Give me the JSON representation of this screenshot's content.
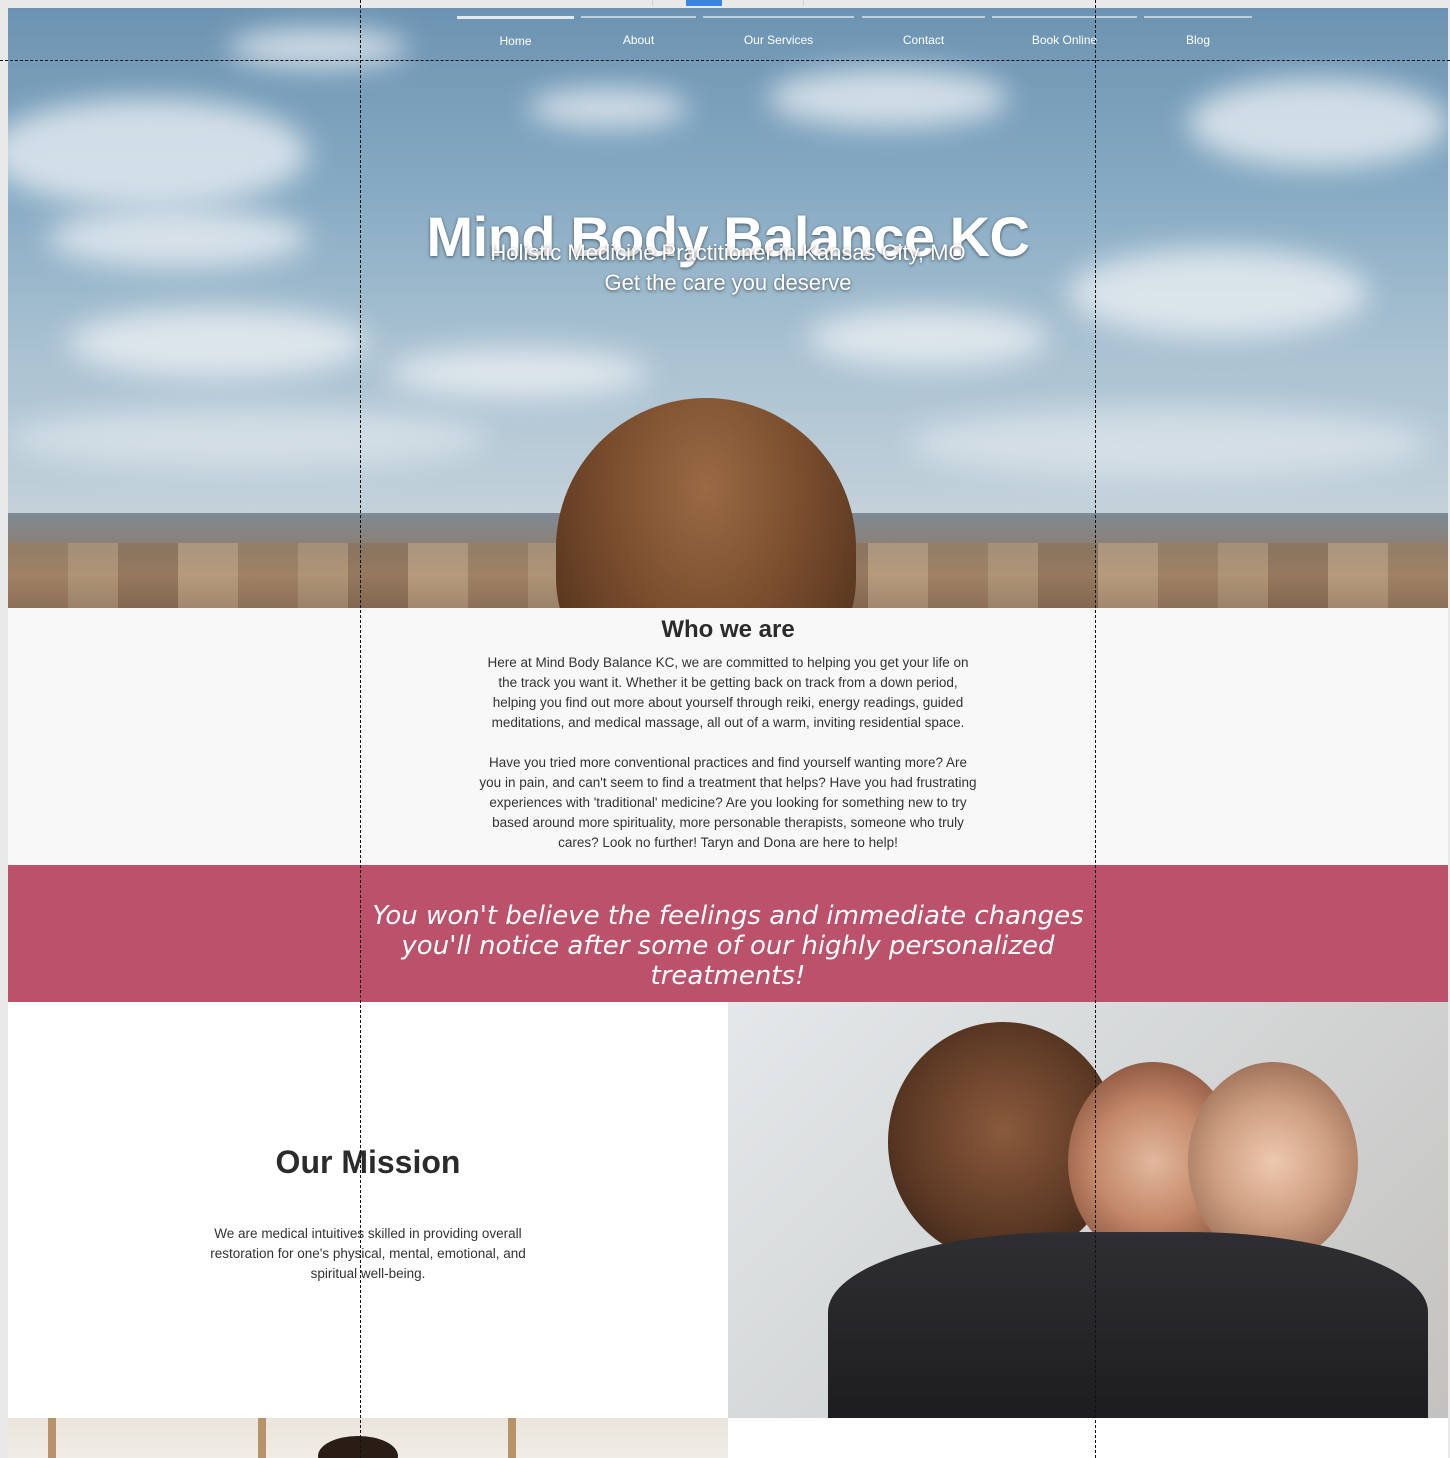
{
  "nav": {
    "items": [
      {
        "label": "Home",
        "active": true
      },
      {
        "label": "About",
        "active": false
      },
      {
        "label": "Our Services",
        "active": false
      },
      {
        "label": "Contact",
        "active": false
      },
      {
        "label": "Book Online",
        "active": false
      },
      {
        "label": "Blog",
        "active": false
      }
    ]
  },
  "hero": {
    "title": "Mind Body Balance KC",
    "subtitle_line1": "Holistic Medicine Practitioner in Kansas City, MO",
    "subtitle_line2": "Get the care you deserve"
  },
  "who": {
    "heading": "Who we are",
    "paragraph1": "Here at Mind Body Balance KC, we are committed to helping you get your life on the track you want it. Whether it be getting back on track from a down period, helping you find out more about yourself through reiki, energy readings, guided meditations, and medical massage, all out of a warm, inviting residential space.",
    "paragraph2": "Have you tried more conventional practices and find yourself wanting more? Are you in pain, and can't seem to find a treatment that helps? Have you had frustrating experiences with 'traditional' medicine? Are you looking for something new to try based around more spirituality, more personable therapists, someone who truly cares? Look no further! Taryn and Dona are here to help!"
  },
  "quote": {
    "text": "You won't believe the feelings and immediate changes you'll notice after some of our highly personalized treatments!"
  },
  "mission": {
    "heading": "Our Mission",
    "text": "We are medical intuitives skilled in providing overall restoration for one's physical, mental, emotional, and spiritual well-being."
  },
  "colors": {
    "band": "#bb516a",
    "text_dark": "#2b2b2b",
    "section_bg": "#f8f8f8"
  }
}
